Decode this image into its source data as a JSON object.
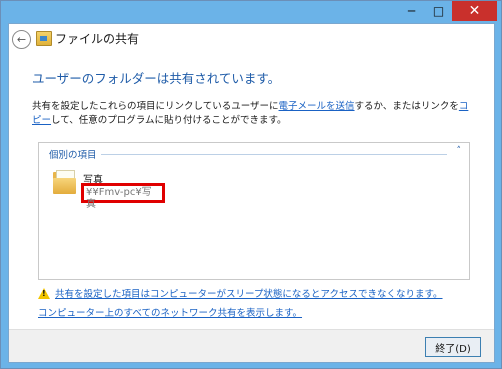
{
  "window": {
    "minimize_glyph": "─",
    "maximize_glyph": "□",
    "close_glyph": "✕"
  },
  "nav": {
    "back_glyph": "←",
    "title": "ファイルの共有"
  },
  "main": {
    "heading": "ユーザーのフォルダーは共有されています。",
    "desc_before_email": "共有を設定したこれらの項目にリンクしているユーザーに",
    "email_link": "電子メールを送信",
    "desc_middle": "するか、またはリンクを",
    "copy_link": "コピー",
    "desc_after": "して、任意のプログラムに貼り付けることができます。"
  },
  "group": {
    "header": "個別の項目",
    "collapse_glyph": "˄",
    "item": {
      "name": "写真",
      "path": "¥¥Fmv-pc¥写真"
    }
  },
  "links": {
    "warning_link": "共有を設定した項目はコンピューターがスリープ状態になるとアクセスできなくなります。",
    "network_link": "コンピューター上のすべてのネットワーク共有を表示します。"
  },
  "footer": {
    "finish_button": "終了(D)"
  },
  "colors": {
    "title_bar": "#6bb3e8",
    "heading_blue": "#1e5ba8",
    "link_blue": "#1a62c4",
    "highlight_red": "#e00000",
    "close_red": "#c9302c"
  }
}
